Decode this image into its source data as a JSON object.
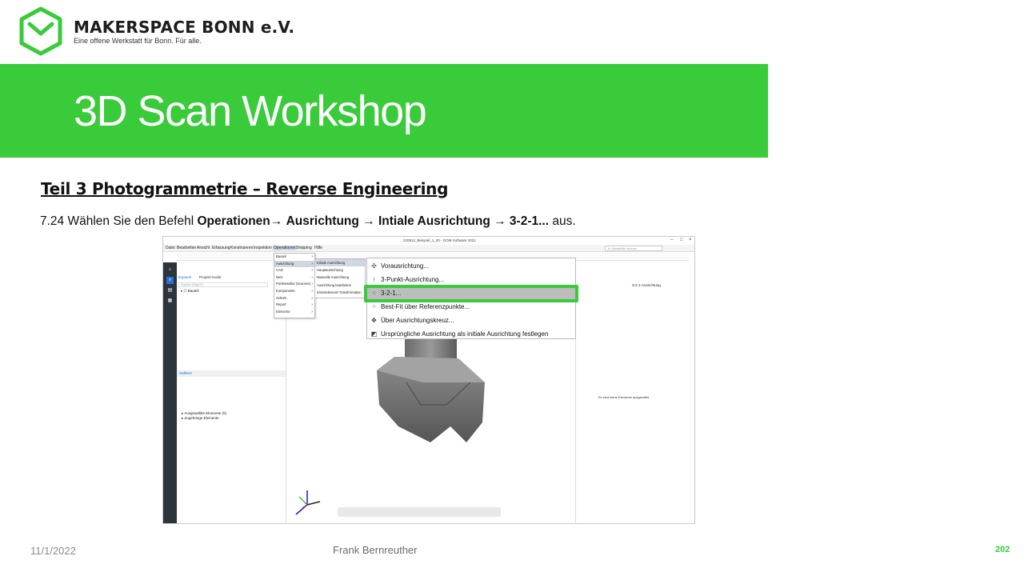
{
  "organization": {
    "name": "MAKERSPACE BONN e.V.",
    "tagline": "Eine offene Werkstatt für Bonn. Für alle."
  },
  "banner": {
    "title": "3D Scan Workshop"
  },
  "section_title": "Teil 3  Photogrammetrie  – Reverse Engineering",
  "instruction": {
    "prefix": "7.24 Wählen Sie den Befehl",
    "steps": [
      "Operationen",
      "Ausrichtung",
      "Intiale Ausrichtung",
      "3-2-1..."
    ],
    "suffix": "aus."
  },
  "screenshot": {
    "window_title": "220912_Beispiel_1_00 - GOM Software 2021",
    "menubar": [
      "Datei",
      "Bearbeiten",
      "Ansicht",
      "Erfassung",
      "Konstruieren",
      "Inspektion",
      "Operationen",
      "Stripping",
      "Hilfe"
    ],
    "search_placeholder": "In Detailhilfe suchen",
    "left_tabs": [
      "Explorer",
      "Projekt-Guide"
    ],
    "left_search_placeholder": "Suchen (Strg+F)",
    "tree_item": "Bauteil",
    "lower_tabs": [
      "Gefiltert",
      "Ausgewählte Elemente (0)",
      "Zugehörige Elemente"
    ],
    "right_panel_title": "3-2-1-Ausrichtung",
    "right_panel_note": "Es sind keine Elemente ausgewählt.",
    "menu_operationen": [
      "Bauteil",
      "Ausrichtung",
      "CAD",
      "Netz",
      "Punktewolke (Scanner)",
      "Komponente",
      "Schnitt",
      "Report",
      "Elemente"
    ],
    "menu_ausrichtung": [
      "Initiale Ausrichtung",
      "Hauptausrichtung",
      "Manuelle Ausrichtung",
      "Ausrichtung bearbeiten",
      "Einzelelement-Transformation"
    ],
    "menu_initial": [
      {
        "icon": "pre-alignment-icon",
        "label": "Vorausrichtung..."
      },
      {
        "icon": "three-point-icon",
        "label": "3-Punkt-Ausrichtung..."
      },
      {
        "icon": "three-two-one-icon",
        "label": "3-2-1..."
      },
      {
        "icon": "best-fit-icon",
        "label": "Best-Fit über Referenzpunkte..."
      },
      {
        "icon": "cross-icon",
        "label": "Über Ausrichtungskreuz..."
      },
      {
        "icon": "original-alignment-icon",
        "label": "Ursprüngliche Ausrichtung als initiale Ausrichtung festlegen"
      }
    ]
  },
  "footer": {
    "date": "11/1/2022",
    "author": "Frank Bernreuther",
    "page": "202"
  },
  "colors": {
    "accent": "#39cb39",
    "menu_highlight": "#bdbdbd"
  }
}
